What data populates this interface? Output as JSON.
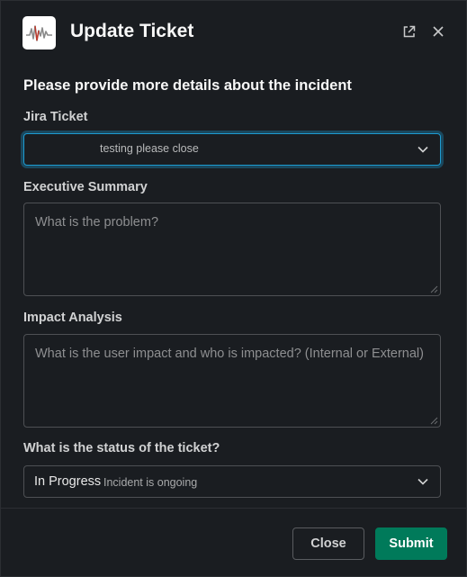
{
  "header": {
    "title": "Update Ticket",
    "app_icon": "waveform-icon",
    "open_new_window_icon": "external-link-icon",
    "close_icon": "close-icon"
  },
  "form": {
    "section_title": "Please provide more details about the incident",
    "jira_ticket": {
      "label": "Jira Ticket",
      "selected_value": "testing please close"
    },
    "executive_summary": {
      "label": "Executive Summary",
      "placeholder": "What is the problem?"
    },
    "impact_analysis": {
      "label": "Impact Analysis",
      "placeholder": "What is the user impact and who is impacted? (Internal or External)"
    },
    "ticket_status": {
      "label": "What is the status of the ticket?",
      "selected_value": "In Progress",
      "selected_description": "Incident is ongoing"
    }
  },
  "footer": {
    "close_label": "Close",
    "submit_label": "Submit"
  },
  "colors": {
    "background": "#1a1d21",
    "focus_ring": "#1d9bd1",
    "submit": "#007a5a"
  }
}
